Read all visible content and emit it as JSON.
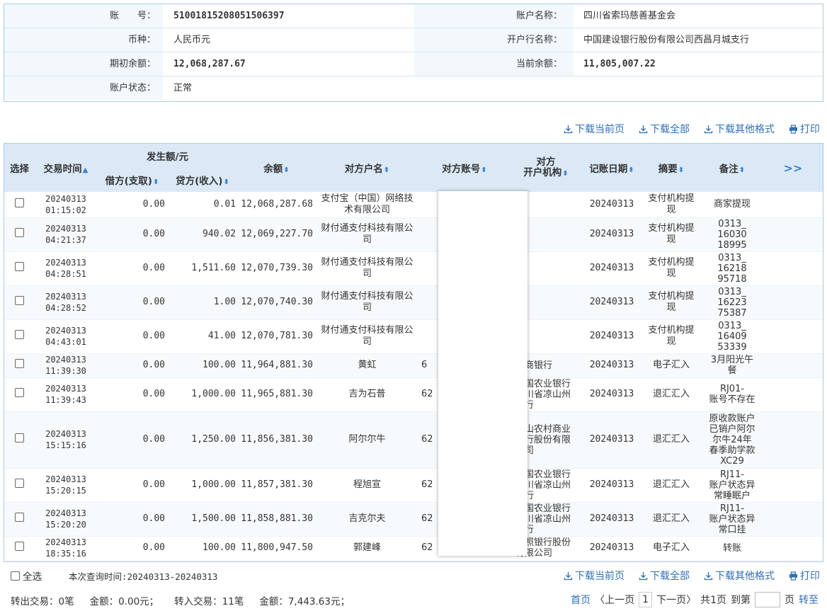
{
  "account": {
    "account_no_label": "账　　号：",
    "account_no": "51001815208051506397",
    "account_name_label": "账户名称：",
    "account_name": "四川省索玛慈善基金会",
    "currency_label": "币种：",
    "currency": "人民币元",
    "bank_label": "开户行名称：",
    "bank": "中国建设银行股份有限公司西昌月城支行",
    "opening_label": "期初余额：",
    "opening": "12,068,287.67",
    "current_label": "当前余额：",
    "current": "11,805,007.22",
    "status_label": "账户状态：",
    "status": "正常"
  },
  "toolbar": {
    "download_page": "下载当前页",
    "download_all": "下载全部",
    "download_other": "下载其他格式",
    "print": "打印"
  },
  "table": {
    "headers": {
      "select": "选择",
      "time": "交易时间",
      "amount_group": "发生额/元",
      "debit": "借方(支取)",
      "credit": "贷方(收入)",
      "balance": "余额",
      "party_name": "对方户名",
      "party_account": "对方账号",
      "party_bank": "对方\n开户机构",
      "post_date": "记账日期",
      "summary": "摘要",
      "remark": "备注",
      "more": ">>"
    },
    "rows": [
      {
        "time": "20240313\n01:15:02",
        "debit": "0.00",
        "credit": "0.01",
        "balance": "12,068,287.68",
        "name": "支付宝（中国）网络技\n术有限公司",
        "acct": "",
        "bank": "",
        "date": "20240313",
        "summary": "支付机构提\n现",
        "remark": "商家提现"
      },
      {
        "time": "20240313\n04:21:37",
        "debit": "0.00",
        "credit": "940.02",
        "balance": "12,069,227.70",
        "name": "财付通支付科技有限公\n司",
        "acct": "",
        "bank": "",
        "date": "20240313",
        "summary": "支付机构提\n现",
        "remark": "0313_\n16030\n18995"
      },
      {
        "time": "20240313\n04:28:51",
        "debit": "0.00",
        "credit": "1,511.60",
        "balance": "12,070,739.30",
        "name": "财付通支付科技有限公\n司",
        "acct": "",
        "bank": "",
        "date": "20240313",
        "summary": "支付机构提\n现",
        "remark": "0313_\n16218\n95718"
      },
      {
        "time": "20240313\n04:28:52",
        "debit": "0.00",
        "credit": "1.00",
        "balance": "12,070,740.30",
        "name": "财付通支付科技有限公\n司",
        "acct": "",
        "bank": "",
        "date": "20240313",
        "summary": "支付机构提\n现",
        "remark": "0313_\n16223\n75387"
      },
      {
        "time": "20240313\n04:43:01",
        "debit": "0.00",
        "credit": "41.00",
        "balance": "12,070,781.30",
        "name": "财付通支付科技有限公\n司",
        "acct": "",
        "bank": "",
        "date": "20240313",
        "summary": "支付机构提\n现",
        "remark": "0313_\n16409\n53339"
      },
      {
        "time": "20240313\n11:39:30",
        "debit": "0.00",
        "credit": "100.00",
        "balance": "11,964,881.30",
        "name": "黄虹",
        "acct": "6",
        "bank": "招商银行",
        "date": "20240313",
        "summary": "电子汇入",
        "remark": "3月阳光午\n餐"
      },
      {
        "time": "20240313\n11:39:43",
        "debit": "0.00",
        "credit": "1,000.00",
        "balance": "11,965,881.30",
        "name": "吉为石普",
        "acct": "62",
        "bank": "中国农业银行\n四川省凉山州\n分行",
        "date": "20240313",
        "summary": "退汇汇入",
        "remark": "RJ01-\n账号不存在"
      },
      {
        "time": "20240313\n15:15:16",
        "debit": "0.00",
        "credit": "1,250.00",
        "balance": "11,856,381.30",
        "name": "阿尔尔牛",
        "acct": "62",
        "bank": "凉山农村商业\n银行股份有限\n公司",
        "date": "20240313",
        "summary": "退汇汇入",
        "remark": "原收款账户\n已销户阿尔\n尔牛24年\n春季助学款\nXC29"
      },
      {
        "time": "20240313\n15:20:15",
        "debit": "0.00",
        "credit": "1,000.00",
        "balance": "11,857,381.30",
        "name": "程旭宣",
        "acct": "62",
        "bank": "中国农业银行\n四川省凉山州\n分行",
        "date": "20240313",
        "summary": "退汇汇入",
        "remark": "RJ11-\n账户状态异\n常睡眠户"
      },
      {
        "time": "20240313\n15:20:20",
        "debit": "0.00",
        "credit": "1,500.00",
        "balance": "11,858,881.30",
        "name": "吉克尔夫",
        "acct": "62",
        "bank": "中国农业银行\n四川省凉山州\n分行",
        "date": "20240313",
        "summary": "退汇汇入",
        "remark": "RJ11-\n账户状态异\n常口挂"
      },
      {
        "time": "20240313\n18:35:16",
        "debit": "0.00",
        "credit": "100.00",
        "balance": "11,800,947.50",
        "name": "郭建峰",
        "acct": "62",
        "bank": "日照银行股份\n有限公司",
        "date": "20240313",
        "summary": "电子汇入",
        "remark": "转账"
      }
    ]
  },
  "footer": {
    "select_all": "全选",
    "query_time": "本次查询时间:20240313-20240313",
    "out_trans": "转出交易：0笔",
    "out_amount": "金额：0.00元；",
    "in_trans": "转入交易：11笔",
    "in_amount": "金额：7,443.63元；"
  },
  "pager": {
    "first": "首页",
    "prev": "〈上一页",
    "current": "1",
    "next": "下一页〉",
    "total": "共1页",
    "goto": "到第",
    "page_unit": "页",
    "jump": "转至"
  },
  "colors": {
    "link": "#2f6fb5",
    "header_bg": "#dbe9f7",
    "border": "#a9c8e4"
  }
}
